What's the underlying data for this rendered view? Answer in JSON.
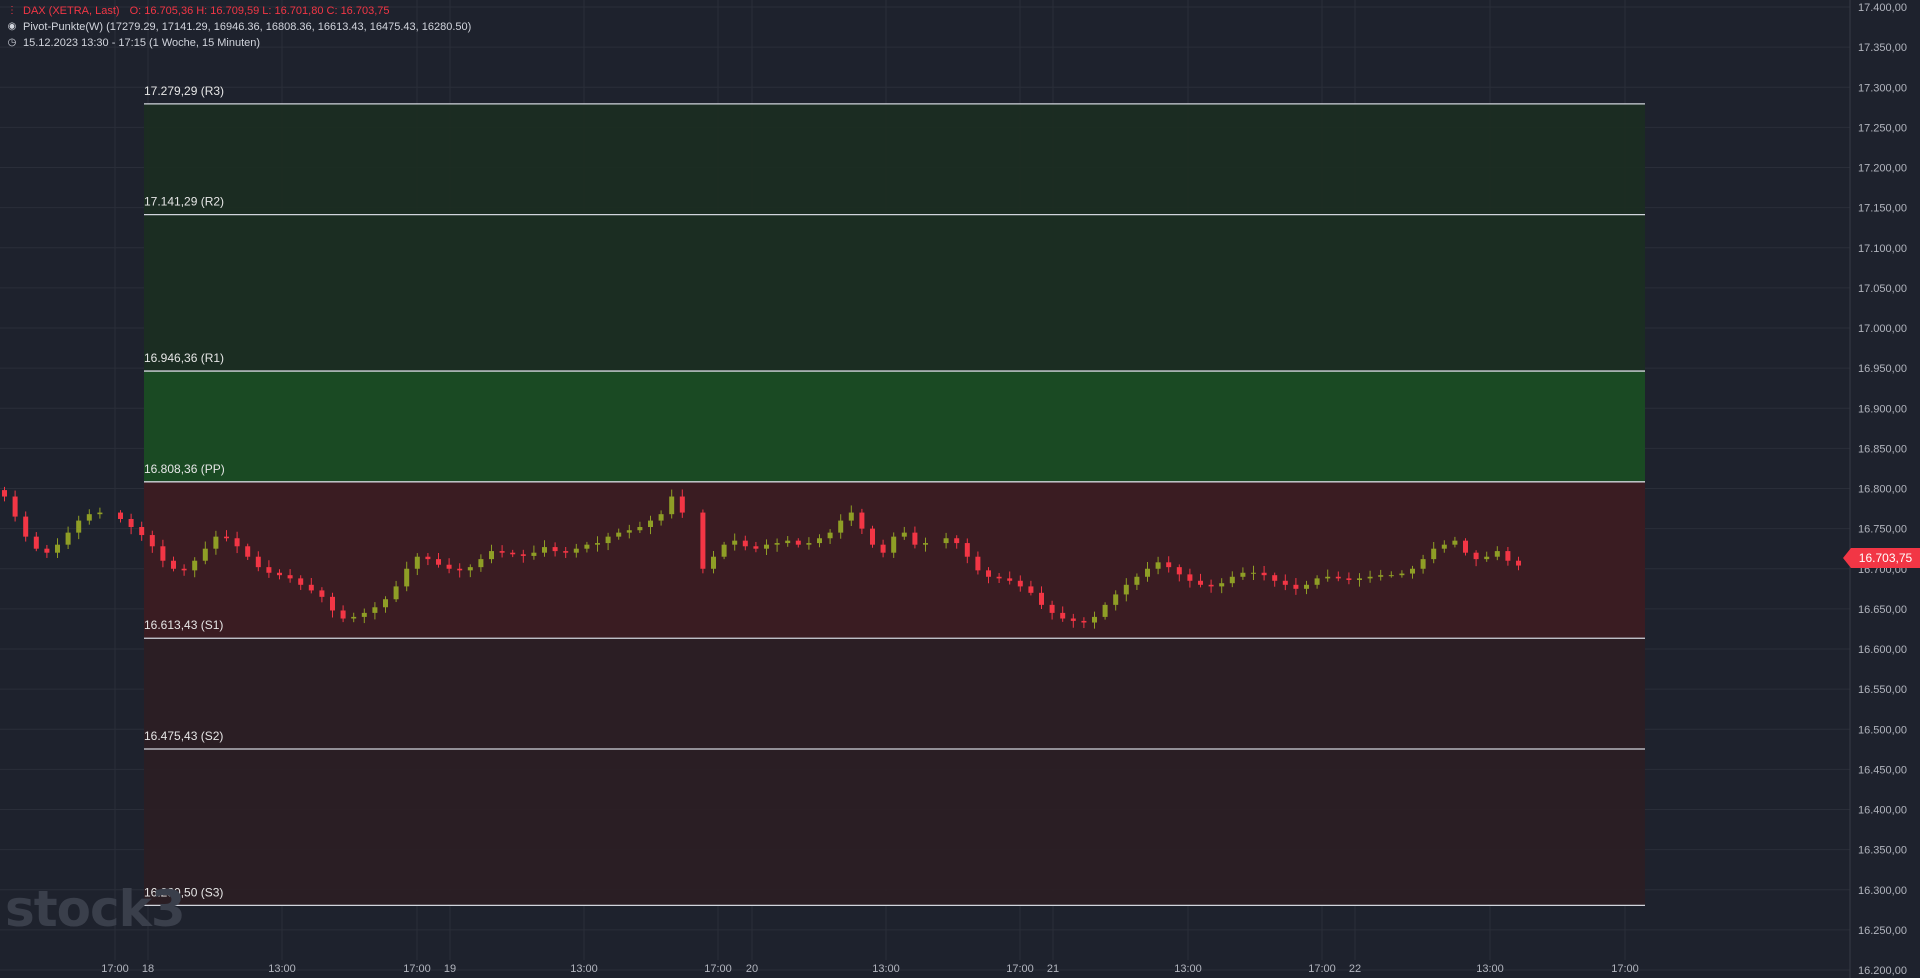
{
  "header": {
    "symbol_line": "DAX (XETRA, Last)",
    "ohlc": "O: 16.705,36  H: 16.709,59  L: 16.701,80  C: 16.703,75",
    "indicator_line": "Pivot-Punkte(W)  (17279.29,  17141.29,  16946.36,  16808.36,  16613.43,  16475.43,  16280.50)",
    "range_line": "15.12.2023 13:30 - 17:15   (1 Woche, 15 Minuten)"
  },
  "watermark": "stock3",
  "last_price_label": "16.703,75",
  "colors": {
    "background": "#1e222d",
    "up": "#8f9e26",
    "down": "#f23645",
    "pivot_line": "#d1d4dc",
    "zone_green_strong": "#1a4a23",
    "zone_green_weak": "#1b2d22",
    "zone_red_strong": "#3a1c22",
    "zone_red_weak": "#2b1e24",
    "badge": "#f23645"
  },
  "chart_data": {
    "type": "candlestick",
    "y_axis": {
      "min": 16200,
      "max": 17400,
      "ticks": [
        "16.200,00",
        "16.250,00",
        "16.300,00",
        "16.350,00",
        "16.400,00",
        "16.450,00",
        "16.500,00",
        "16.550,00",
        "16.600,00",
        "16.650,00",
        "16.700,00",
        "16.750,00",
        "16.800,00",
        "16.850,00",
        "16.900,00",
        "16.950,00",
        "17.000,00",
        "17.050,00",
        "17.100,00",
        "17.150,00",
        "17.200,00",
        "17.250,00",
        "17.300,00",
        "17.350,00",
        "17.400,00"
      ],
      "tick_values": [
        16200,
        16250,
        16300,
        16350,
        16400,
        16450,
        16500,
        16550,
        16600,
        16650,
        16700,
        16750,
        16800,
        16850,
        16900,
        16950,
        17000,
        17050,
        17100,
        17150,
        17200,
        17250,
        17300,
        17350,
        17400
      ],
      "position": "right"
    },
    "x_axis": {
      "labels": [
        "17:00",
        "18",
        "13:00",
        "17:00",
        "19",
        "13:00",
        "17:00",
        "20",
        "13:00",
        "17:00",
        "21",
        "13:00",
        "17:00",
        "22",
        "13:00",
        "17:00"
      ]
    },
    "pivot_levels": [
      {
        "name": "R3",
        "value": 17279.29,
        "label": "17.279,29 (R3)"
      },
      {
        "name": "R2",
        "value": 17141.29,
        "label": "17.141,29 (R2)"
      },
      {
        "name": "R1",
        "value": 16946.36,
        "label": "16.946,36 (R1)"
      },
      {
        "name": "PP",
        "value": 16808.36,
        "label": "16.808,36 (PP)"
      },
      {
        "name": "S1",
        "value": 16613.43,
        "label": "16.613,43 (S1)"
      },
      {
        "name": "S2",
        "value": 16475.43,
        "label": "16.475,43 (S2)"
      },
      {
        "name": "S3",
        "value": 16280.5,
        "label": "16.280,50 (S3)"
      }
    ],
    "close_path": [
      16790,
      16765,
      16740,
      16725,
      16720,
      16730,
      16745,
      16760,
      16768,
      16770,
      16762,
      16752,
      16742,
      16728,
      16710,
      16700,
      16698,
      16710,
      16725,
      16740,
      16738,
      16728,
      16715,
      16702,
      16695,
      16692,
      16688,
      16680,
      16673,
      16665,
      16648,
      16638,
      16640,
      16645,
      16652,
      16662,
      16678,
      16700,
      16715,
      16712,
      16705,
      16700,
      16698,
      16702,
      16712,
      16722,
      16720,
      16718,
      16716,
      16720,
      16727,
      16722,
      16720,
      16725,
      16730,
      16732,
      16740,
      16745,
      16748,
      16752,
      16760,
      16768,
      16790,
      16770,
      16700,
      16715,
      16730,
      16735,
      16728,
      16725,
      16730,
      16732,
      16735,
      16730,
      16732,
      16738,
      16745,
      16760,
      16770,
      16750,
      16730,
      16720,
      16740,
      16745,
      16730,
      16732,
      16738,
      16732,
      16715,
      16698,
      16690,
      16688,
      16685,
      16678,
      16670,
      16655,
      16645,
      16638,
      16635,
      16633,
      16640,
      16655,
      16668,
      16680,
      16690,
      16700,
      16708,
      16702,
      16693,
      16685,
      16680,
      16678,
      16682,
      16690,
      16695,
      16695,
      16692,
      16685,
      16680,
      16675,
      16680,
      16688,
      16690,
      16688,
      16686,
      16688,
      16690,
      16692,
      16692,
      16694,
      16700,
      16712,
      16725,
      16730,
      16735,
      16720,
      16712,
      16715,
      16722,
      16710,
      16704
    ],
    "last_close": 16703.75
  }
}
